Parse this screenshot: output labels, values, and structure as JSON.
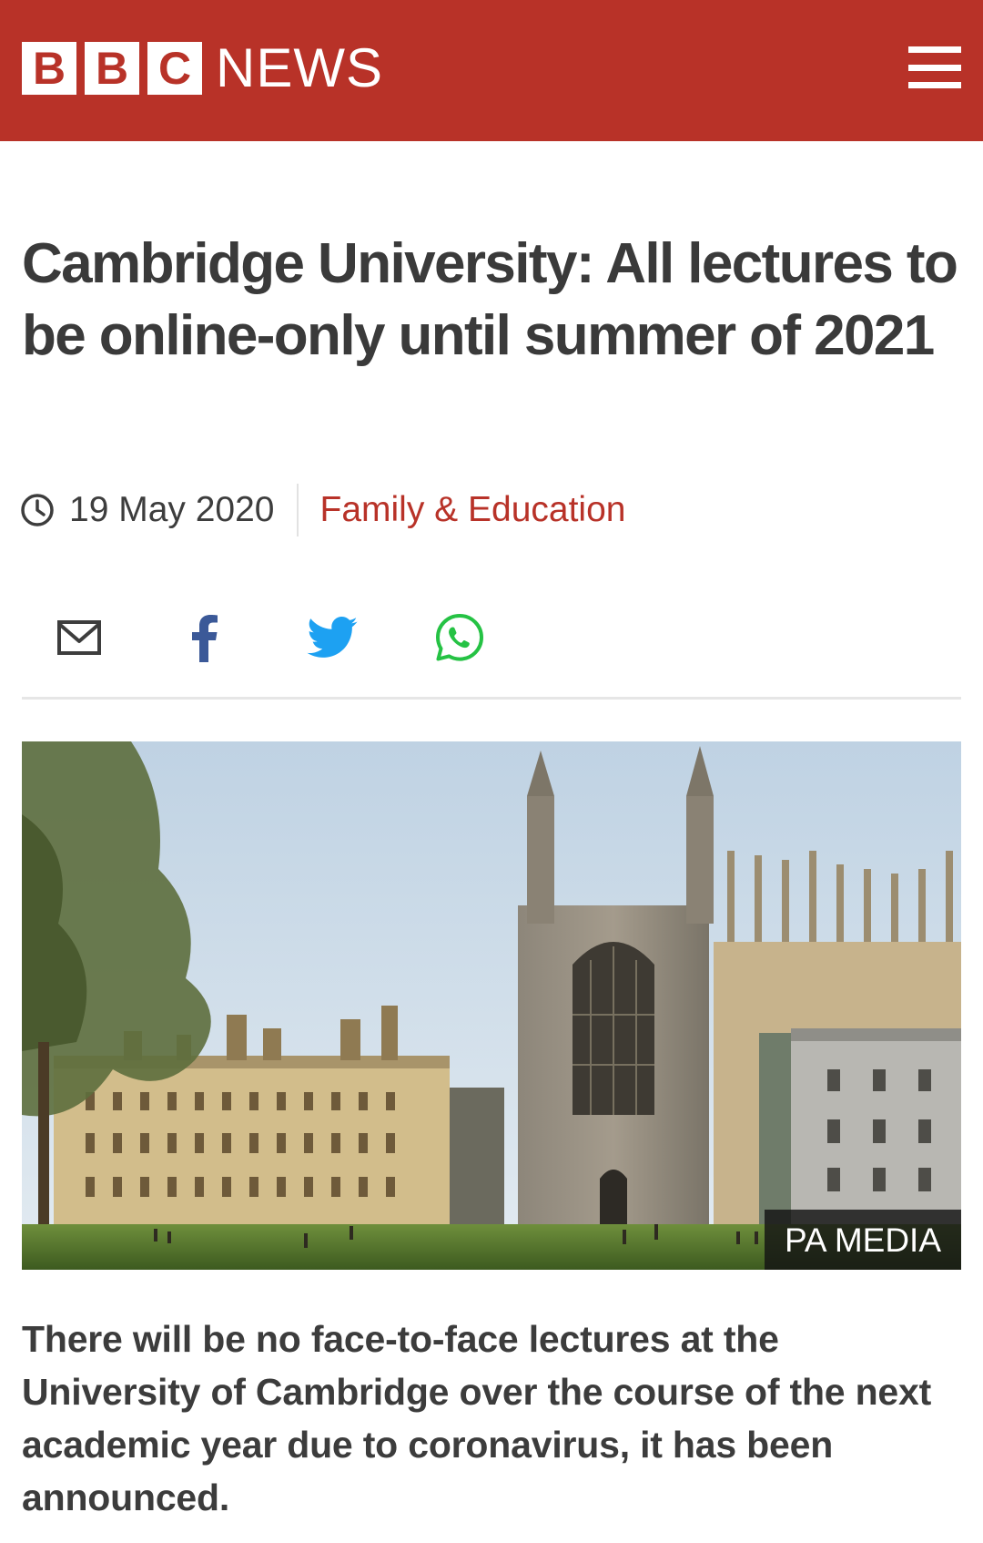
{
  "header": {
    "logo_letters": [
      "B",
      "B",
      "C"
    ],
    "logo_word": "NEWS",
    "background_color": "#b83228",
    "menu_icon": "hamburger-menu-icon"
  },
  "article": {
    "headline": "Cambridge University: All lectures to be online-only until summer of 2021",
    "date": "19 May 2020",
    "category": "Family & Education",
    "accent_color": "#b83228",
    "share": {
      "icons": [
        "email-icon",
        "facebook-icon",
        "twitter-icon",
        "whatsapp-icon"
      ]
    },
    "image": {
      "credit": "PA MEDIA"
    },
    "lead": "There will be no face-to-face lectures at the University of Cambridge over the course of the next academic year due to coronavirus, it has been announced."
  }
}
